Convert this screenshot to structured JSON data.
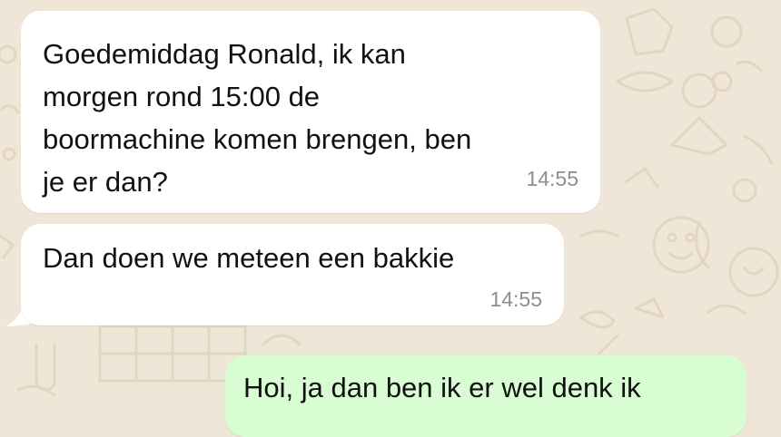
{
  "conversation": {
    "messages": [
      {
        "direction": "incoming",
        "text": "Goedemiddag Ronald, ik kan\nmorgen rond 15:00 de\nboormachine komen brengen, ben\nje er dan?",
        "time": "14:55"
      },
      {
        "direction": "incoming",
        "text": "Dan doen we meteen een bakkie",
        "time": "14:55"
      },
      {
        "direction": "outgoing",
        "text": "Hoi, ja dan ben ik er wel denk ik",
        "time": ""
      }
    ]
  },
  "theme": {
    "wallpaper_color": "#EFE6D7",
    "doodle_color": "#E2D6C2",
    "incoming_bubble_color": "#FFFFFF",
    "outgoing_bubble_color": "#D9FDD3",
    "text_color": "#111111",
    "timestamp_color": "#8E8E8E"
  }
}
